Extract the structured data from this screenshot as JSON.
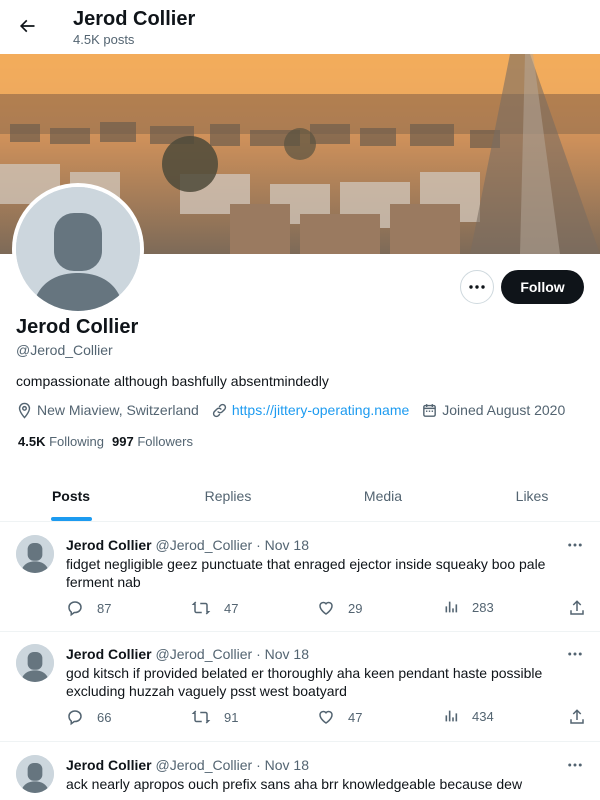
{
  "header": {
    "title": "Jerod Collier",
    "posts_count": "4.5K posts"
  },
  "profile": {
    "name": "Jerod Collier",
    "handle": "@Jerod_Collier",
    "bio": "compassionate although bashfully absentmindedly",
    "location": "New Miaview, Switzerland",
    "website": "https://jittery-operating.name",
    "joined": "Joined August 2020",
    "following_count": "4.5K",
    "following_label": "Following",
    "followers_count": "997",
    "followers_label": "Followers",
    "follow_label": "Follow"
  },
  "tabs": [
    {
      "label": "Posts",
      "active": true
    },
    {
      "label": "Replies",
      "active": false
    },
    {
      "label": "Media",
      "active": false
    },
    {
      "label": "Likes",
      "active": false
    }
  ],
  "tweets": [
    {
      "name": "Jerod Collier",
      "handle": "@Jerod_Collier",
      "dot": "·",
      "date": "Nov 18",
      "text": "fidget negligible geez punctuate that enraged ejector inside squeaky boo pale ferment nab",
      "replies": "87",
      "retweets": "47",
      "likes": "29",
      "views": "283"
    },
    {
      "name": "Jerod Collier",
      "handle": "@Jerod_Collier",
      "dot": "·",
      "date": "Nov 18",
      "text": "god kitsch if provided belated er thoroughly aha keen pendant haste possible excluding huzzah vaguely psst west boatyard",
      "replies": "66",
      "retweets": "91",
      "likes": "47",
      "views": "434"
    },
    {
      "name": "Jerod Collier",
      "handle": "@Jerod_Collier",
      "dot": "·",
      "date": "Nov 18",
      "text": "ack nearly apropos ouch prefix sans aha brr knowledgeable because dew"
    }
  ],
  "icons": {
    "back": "arrow-left-icon",
    "more": "more-horizontal-icon",
    "location": "location-pin-icon",
    "link": "link-icon",
    "calendar": "calendar-icon",
    "reply": "reply-icon",
    "retweet": "retweet-icon",
    "like": "heart-icon",
    "views": "views-bar-icon",
    "share": "share-icon"
  },
  "colors": {
    "accent": "#1d9bf0",
    "text": "#0f1419",
    "secondary": "#536471",
    "follow_button": "#0f1419"
  }
}
